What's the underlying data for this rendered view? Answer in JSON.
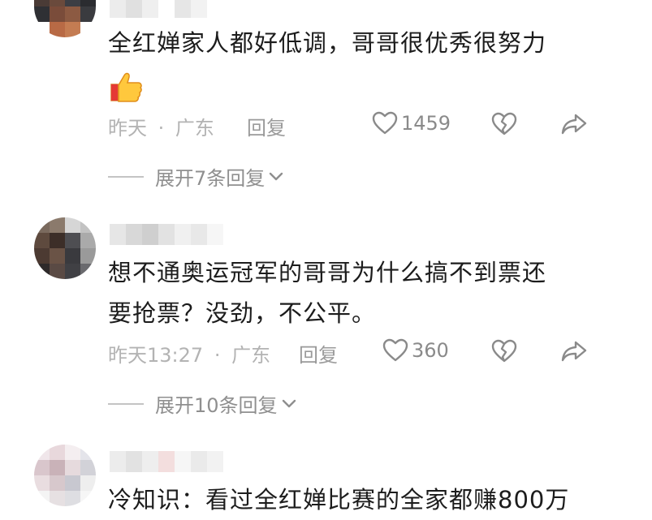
{
  "comments": [
    {
      "username": "",
      "text_lines": [
        "全红婵家人都好低调，哥哥很优秀很努力"
      ],
      "emoji": "thumbs-up",
      "time": "昨天",
      "location": "广东",
      "separator": "·",
      "reply_label": "回复",
      "likes": "1459",
      "expand_label": "展开7条回复"
    },
    {
      "username": "",
      "text_lines": [
        "想不通奥运冠军的哥哥为什么搞不到票还",
        "要抢票？没劲，不公平。"
      ],
      "time": "昨天13:27",
      "location": "广东",
      "separator": "·",
      "reply_label": "回复",
      "likes": "360",
      "expand_label": "展开10条回复"
    },
    {
      "username": "",
      "text_lines": [
        "冷知识：看过全红婵比赛的全家都赚800万"
      ]
    }
  ],
  "icons": {
    "like": "heart-outline-icon",
    "dislike": "broken-heart-icon",
    "share": "share-arrow-icon",
    "expand": "chevron-down-icon"
  },
  "colors": {
    "text": "#1c1c1c",
    "meta": "#b3b3b3",
    "action": "#8a8a8a"
  }
}
